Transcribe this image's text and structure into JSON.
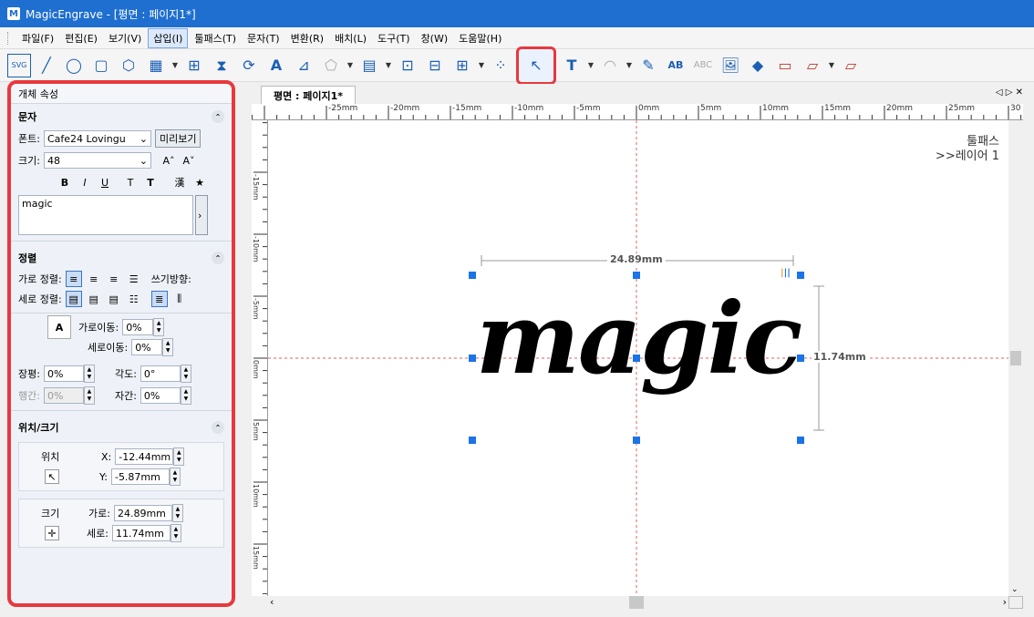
{
  "window": {
    "title": "MagicEngrave - [평면 : 페이지1*]",
    "logo": "M"
  },
  "menu": [
    "파일(F)",
    "편집(E)",
    "보기(V)",
    "삽입(I)",
    "툴패스(T)",
    "문자(T)",
    "변환(R)",
    "배치(L)",
    "도구(T)",
    "창(W)",
    "도움말(H)"
  ],
  "menu_active_index": 3,
  "panel": {
    "title": "개체 속성",
    "text_section": {
      "heading": "문자",
      "font_label": "폰트:",
      "font_value": "Cafe24 Lovingu",
      "preview_button": "미리보기",
      "size_label": "크기:",
      "size_value": "48",
      "style_buttons": [
        "B",
        "I",
        "U",
        "T",
        "T",
        "漢",
        "★"
      ],
      "text_value": "magic"
    },
    "align_section": {
      "heading": "정렬",
      "h_align_label": "가로 정렬:",
      "v_align_label": "세로 정렬:",
      "direction_label": "쓰기방향:",
      "h_move_label": "가로이동:",
      "h_move_value": "0%",
      "v_move_label": "세로이동:",
      "v_move_value": "0%",
      "width_ratio_label": "장평:",
      "width_ratio_value": "0%",
      "angle_label": "각도:",
      "angle_value": "0°",
      "line_spacing_label": "행간:",
      "line_spacing_value": "0%",
      "char_spacing_label": "자간:",
      "char_spacing_value": "0%"
    },
    "position_section": {
      "heading": "위치/크기",
      "position_label": "위치",
      "x_label": "X:",
      "x_value": "-12.44mm",
      "y_label": "Y:",
      "y_value": "-5.87mm",
      "size_label": "크기",
      "w_label": "가로:",
      "w_value": "24.89mm",
      "h_label": "세로:",
      "h_value": "11.74mm"
    }
  },
  "document": {
    "tab_label": "평면 : 페이지1*",
    "toolpath_label": "툴패스",
    "layer_label": ">>레이어 1",
    "object_text": "magic",
    "dim_width": "24.89mm",
    "dim_height": "11.74mm"
  },
  "ruler": {
    "h_labels": [
      "-25mm",
      "-20mm",
      "-15mm",
      "-10mm",
      "-5mm",
      "0mm",
      "5mm",
      "10mm",
      "15mm",
      "20mm",
      "25mm",
      "30"
    ],
    "v_labels": [
      "-15mm",
      "-10mm",
      "-5mm",
      "0mm",
      "5mm",
      "10mm",
      "15mm",
      "20mm"
    ]
  },
  "colors": {
    "title_bg": "#1e6fd0",
    "highlight": "#e8383d",
    "handle": "#1a73e8",
    "guide": "#e06060"
  }
}
